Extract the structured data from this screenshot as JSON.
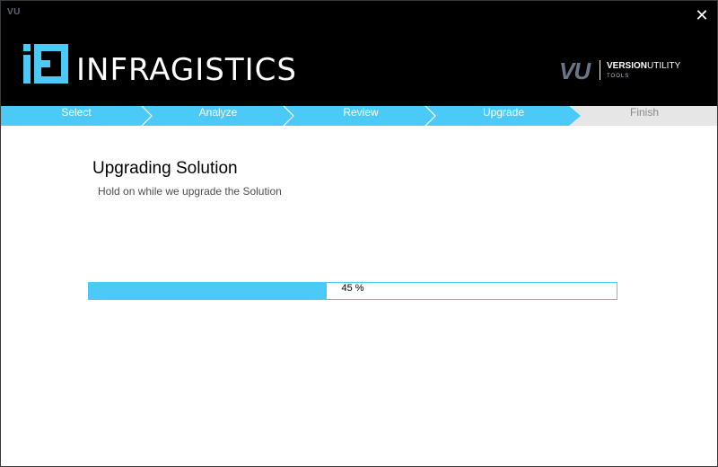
{
  "window": {
    "title_mark": "VU",
    "close_glyph": "✕",
    "close_icon": "close-icon"
  },
  "header": {
    "logo_text": "INFRAGISTICS",
    "logo_icon": "infragistics-logo-icon",
    "vu_mark": "VU",
    "vu_name_bold": "VERSION",
    "vu_name_rest": "UTILITY",
    "vu_tagline": "TOOLS"
  },
  "steps": [
    {
      "label": "Select",
      "state": "done"
    },
    {
      "label": "Analyze",
      "state": "done"
    },
    {
      "label": "Review",
      "state": "done"
    },
    {
      "label": "Upgrade",
      "state": "current"
    },
    {
      "label": "Finish",
      "state": "pending"
    }
  ],
  "main": {
    "title": "Upgrading Solution",
    "subtitle": "Hold on while we upgrade the Solution"
  },
  "progress": {
    "value": 45,
    "label": "45 %"
  },
  "colors": {
    "accent": "#4bc9f7",
    "header_bg": "#000000",
    "step_pending_bg": "#e6e6e6",
    "step_pending_text": "#888888",
    "step_active_text": "#ffffff"
  }
}
